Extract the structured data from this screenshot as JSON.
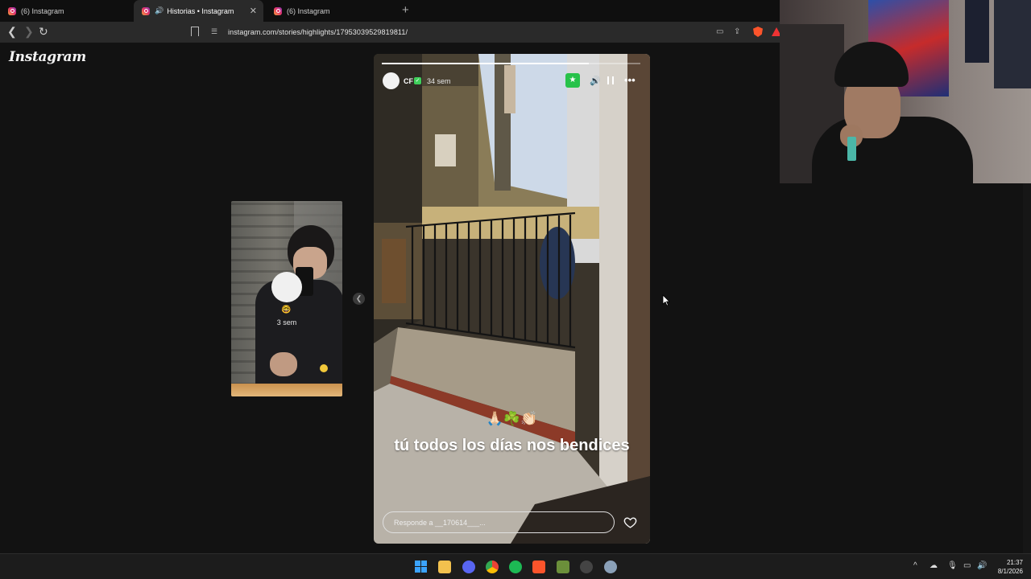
{
  "browser": {
    "tabs": [
      {
        "title": "(6) Instagram",
        "active": false
      },
      {
        "title": "Historias • Instagram",
        "active": true,
        "audio": true
      },
      {
        "title": "(6) Instagram",
        "active": false
      }
    ],
    "url": "instagram.com/stories/highlights/17953039529819811/"
  },
  "page": {
    "logo": "Instagram",
    "previous_story": {
      "time": "3 sem",
      "emoji": "🤓"
    },
    "story": {
      "username": "CF",
      "verified": "✓",
      "time": "34 sem",
      "progress_fraction": 0.8,
      "emojis": "🙏🏻☘️👏🏻",
      "caption": "tú todos los días nos bendices",
      "reply_placeholder": "Responde a __170614___..."
    }
  },
  "taskbar": {
    "time": "21:37",
    "date": "8/1/2026"
  },
  "colors": {
    "background": "#121212",
    "star_badge": "#27c24a",
    "verified": "#3fcf5b"
  }
}
